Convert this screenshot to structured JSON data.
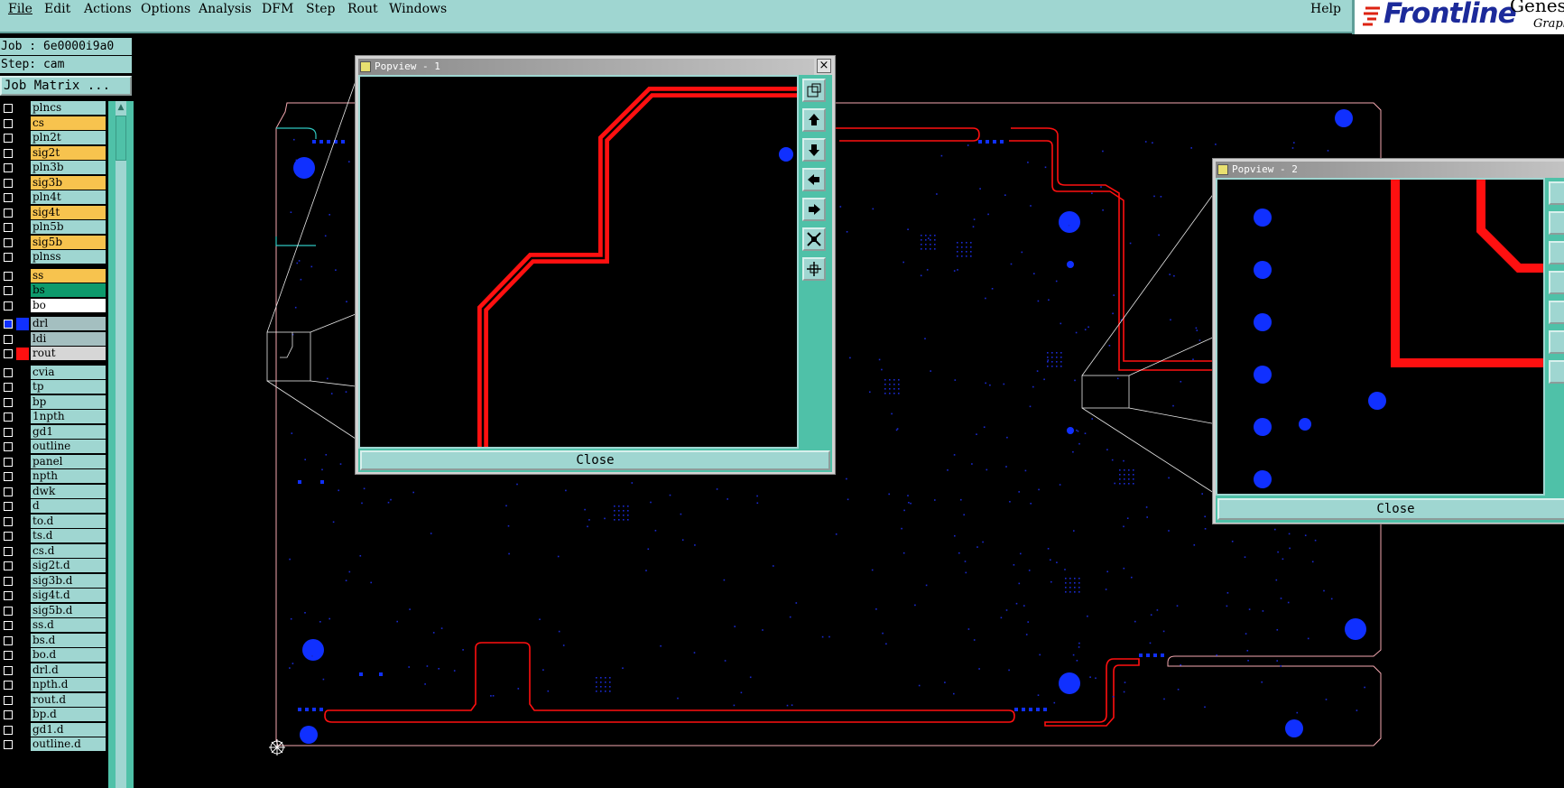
{
  "menubar": {
    "items": [
      "File",
      "Edit",
      "Actions",
      "Options",
      "Analysis",
      "DFM",
      "Step",
      "Rout",
      "Windows"
    ],
    "help": "Help"
  },
  "logo": {
    "brand": "Frontline",
    "product": "Genes",
    "subtitle": "Graph"
  },
  "job": {
    "job_label": "Job : 6e0000i9a0",
    "step_label": "Step: cam",
    "matrix_button": "Job Matrix ..."
  },
  "layers": [
    {
      "name": "plncs",
      "type": "plain"
    },
    {
      "name": "cs",
      "type": "sig"
    },
    {
      "name": "pln2t",
      "type": "plain"
    },
    {
      "name": "sig2t",
      "type": "sig"
    },
    {
      "name": "pln3b",
      "type": "plain"
    },
    {
      "name": "sig3b",
      "type": "sig"
    },
    {
      "name": "pln4t",
      "type": "plain"
    },
    {
      "name": "sig4t",
      "type": "sig"
    },
    {
      "name": "pln5b",
      "type": "plain"
    },
    {
      "name": "sig5b",
      "type": "sig"
    },
    {
      "name": "plnss",
      "type": "plain"
    },
    {
      "name": "ss",
      "type": "sig"
    },
    {
      "name": "bs",
      "type": "bs"
    },
    {
      "name": "bo",
      "type": "bo"
    },
    {
      "name": "drl",
      "type": "drl",
      "swatch": "#1030ff",
      "active": true
    },
    {
      "name": "ldi",
      "type": "drl"
    },
    {
      "name": "rout",
      "type": "rout",
      "swatch": "#ff1010"
    },
    {
      "name": "cvia",
      "type": "plain"
    },
    {
      "name": "tp",
      "type": "plain"
    },
    {
      "name": "bp",
      "type": "plain"
    },
    {
      "name": "1npth",
      "type": "plain"
    },
    {
      "name": "gd1",
      "type": "plain"
    },
    {
      "name": "outline",
      "type": "plain"
    },
    {
      "name": "panel",
      "type": "plain"
    },
    {
      "name": "npth",
      "type": "plain"
    },
    {
      "name": "dwk",
      "type": "plain"
    },
    {
      "name": "d",
      "type": "plain"
    },
    {
      "name": "to.d",
      "type": "plain"
    },
    {
      "name": "ts.d",
      "type": "plain"
    },
    {
      "name": "cs.d",
      "type": "plain"
    },
    {
      "name": "sig2t.d",
      "type": "plain"
    },
    {
      "name": "sig3b.d",
      "type": "plain"
    },
    {
      "name": "sig4t.d",
      "type": "plain"
    },
    {
      "name": "sig5b.d",
      "type": "plain"
    },
    {
      "name": "ss.d",
      "type": "plain"
    },
    {
      "name": "bs.d",
      "type": "plain"
    },
    {
      "name": "bo.d",
      "type": "plain"
    },
    {
      "name": "drl.d",
      "type": "plain"
    },
    {
      "name": "npth.d",
      "type": "plain"
    },
    {
      "name": "rout.d",
      "type": "plain"
    },
    {
      "name": "bp.d",
      "type": "plain"
    },
    {
      "name": "gd1.d",
      "type": "plain"
    },
    {
      "name": "outline.d",
      "type": "plain"
    }
  ],
  "popview1": {
    "title": "Popview - 1",
    "close_label": "Close"
  },
  "popview2": {
    "title": "Popview - 2",
    "close_label": "Close"
  },
  "colors": {
    "panel_teal": "#9fd6d1",
    "frame_green": "#4fc1a8",
    "signal_layer": "#f7c34e",
    "rout": "#ff1010",
    "drill": "#1030ff"
  }
}
